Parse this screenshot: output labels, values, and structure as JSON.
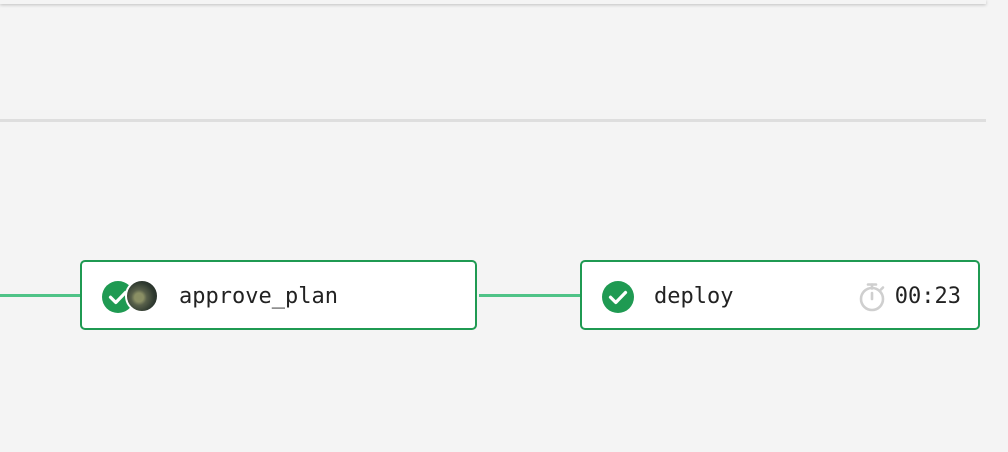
{
  "pipeline": {
    "jobs": [
      {
        "name": "approve_plan",
        "status": "passed",
        "status_icon": "check-circle-icon",
        "has_avatar": true
      },
      {
        "name": "deploy",
        "status": "passed",
        "status_icon": "check-circle-icon",
        "duration": "00:23",
        "duration_icon": "timer-icon"
      }
    ]
  },
  "colors": {
    "success": "#1f9a52",
    "connector": "#4fc387",
    "background": "#f4f4f4",
    "divider": "#dedede",
    "text": "#222222",
    "icon_muted": "#cfcfcf"
  }
}
